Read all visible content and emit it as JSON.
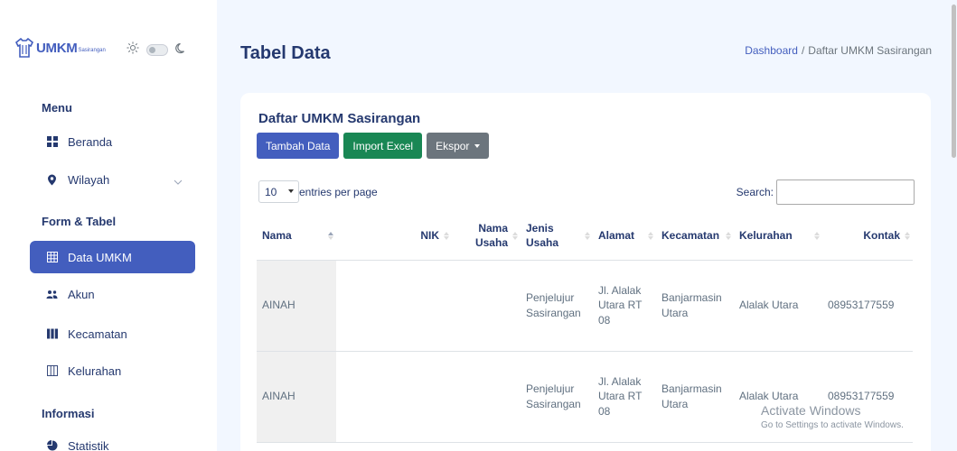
{
  "brand": {
    "name": "UMKM",
    "sub": "Sasirangan"
  },
  "sidebar": {
    "sections": [
      {
        "title": "Menu"
      },
      {
        "title": "Form & Tabel"
      },
      {
        "title": "Informasi"
      }
    ],
    "items": [
      {
        "label": "Beranda",
        "icon": "grid-icon"
      },
      {
        "label": "Wilayah",
        "icon": "map-pin-icon"
      },
      {
        "label": "Data UMKM",
        "icon": "table-icon",
        "active": true
      },
      {
        "label": "Akun",
        "icon": "users-icon"
      },
      {
        "label": "Kecamatan",
        "icon": "columns-icon"
      },
      {
        "label": "Kelurahan",
        "icon": "columns-outline-icon"
      },
      {
        "label": "Statistik",
        "icon": "pie-chart-icon"
      }
    ]
  },
  "header": {
    "title": "Tabel Data",
    "breadcrumb": {
      "home": "Dashboard",
      "separator": "/",
      "current": "Daftar UMKM Sasirangan"
    }
  },
  "card": {
    "title": "Daftar UMKM Sasirangan",
    "buttons": {
      "add": "Tambah Data",
      "import": "Import Excel",
      "export": "Ekspor"
    },
    "entries": {
      "value": "10",
      "label": "entries per page"
    },
    "search_label": "Search:"
  },
  "table": {
    "columns": [
      {
        "line1": "Nama",
        "line2": ""
      },
      {
        "line1": "NIK",
        "line2": ""
      },
      {
        "line1": "Nama",
        "line2": "Usaha"
      },
      {
        "line1": "Jenis",
        "line2": "Usaha"
      },
      {
        "line1": "Alamat",
        "line2": ""
      },
      {
        "line1": "Kecamatan",
        "line2": ""
      },
      {
        "line1": "Kelurahan",
        "line2": ""
      },
      {
        "line1": "Kontak",
        "line2": ""
      }
    ],
    "rows": [
      {
        "nama": "AINAH",
        "nik": "",
        "nama_usaha": "",
        "jenis_usaha": [
          "Penjelujur",
          "Sasirangan"
        ],
        "alamat": [
          "Jl. Alalak",
          "Utara RT",
          "08"
        ],
        "kecamatan": [
          "Banjarmasin",
          "Utara"
        ],
        "kelurahan": "Alalak Utara",
        "kontak": "08953177559"
      },
      {
        "nama": "AINAH",
        "nik": "",
        "nama_usaha": "",
        "jenis_usaha": [
          "Penjelujur",
          "Sasirangan"
        ],
        "alamat": [
          "Jl. Alalak",
          "Utara RT",
          "08"
        ],
        "kecamatan": [
          "Banjarmasin",
          "Utara"
        ],
        "kelurahan": "Alalak Utara",
        "kontak": "08953177559"
      }
    ]
  },
  "overlay": {
    "line1": "Activate Windows",
    "line2": "Go to Settings to activate Windows."
  },
  "colors": {
    "primary": "#435ebe",
    "success": "#198754",
    "secondary": "#6c757d",
    "background": "#f2f7ff",
    "text": "#25396f"
  }
}
